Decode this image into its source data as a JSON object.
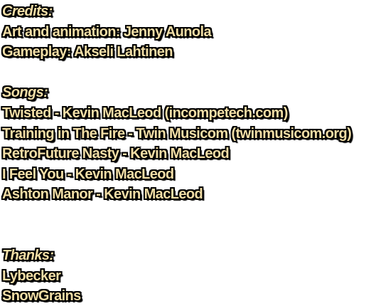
{
  "credits": {
    "heading": "Credits:",
    "art": "Art and animation: Jenny Aunola",
    "gameplay": "Gameplay: Akseli Lahtinen"
  },
  "songs": {
    "heading": "Songs:",
    "items": [
      "Twisted - Kevin MacLeod (incompetech.com)",
      "Training in The Fire - Twin Musicom (twinmusicom.org)",
      "RetroFuture Nasty - Kevin MacLeod",
      "I Feel You - Kevin MacLeod",
      "Ashton Manor - Kevin MacLeod"
    ]
  },
  "thanks": {
    "heading": "Thanks:",
    "items": [
      "Lybecker",
      "SnowGrains"
    ]
  },
  "colors": {
    "text": "#f2dea6",
    "outline": "#000000",
    "background": "#ffffff"
  }
}
